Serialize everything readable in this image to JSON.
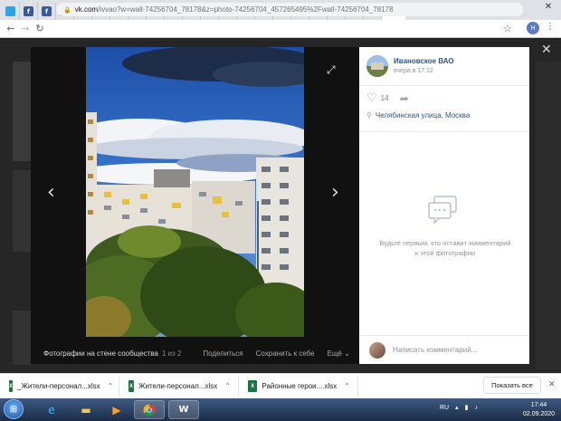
{
  "browser": {
    "tabs": [
      {
        "icon": "telegram-icon",
        "letter": "",
        "color": "#2ca5e0"
      },
      {
        "icon": "facebook-icon",
        "letter": "f",
        "color": "#3b5998"
      },
      {
        "icon": "facebook-icon",
        "letter": "f",
        "color": "#3b5998"
      },
      {
        "icon": "facebook-icon",
        "letter": "f",
        "color": "#3b5998"
      },
      {
        "icon": "globe-icon",
        "letter": "",
        "color": "#888888"
      },
      {
        "icon": "news-icon",
        "letter": "Н",
        "color": "#cfcfcf"
      },
      {
        "icon": "globe-icon",
        "letter": "",
        "color": "#888888"
      },
      {
        "icon": "warning-icon",
        "letter": "!",
        "color": "#e0b000"
      },
      {
        "icon": "document-icon",
        "letter": "",
        "color": "#4a7fd4"
      },
      {
        "icon": "google-icon",
        "letter": "G",
        "color": "#4285f4"
      },
      {
        "icon": "leaf-icon",
        "letter": "",
        "color": "#3fa34d"
      },
      {
        "icon": "globe-icon",
        "letter": "",
        "color": "#888888"
      },
      {
        "icon": "globe-icon",
        "letter": "",
        "color": "#888888"
      },
      {
        "icon": "emblem-icon",
        "letter": "",
        "color": "#c8a400"
      },
      {
        "icon": "globe-icon",
        "letter": "",
        "color": "#888888"
      },
      {
        "icon": "emblem-icon",
        "letter": "",
        "color": "#2d8bd0"
      },
      {
        "icon": "leaf-icon",
        "letter": "",
        "color": "#3fa34d"
      },
      {
        "icon": "globe-icon",
        "letter": "",
        "color": "#888888"
      },
      {
        "icon": "globe-icon",
        "letter": "",
        "color": "#888888"
      },
      {
        "icon": "globe-icon",
        "letter": "",
        "color": "#888888"
      },
      {
        "icon": "emblem-icon",
        "letter": "",
        "color": "#2d8bd0"
      }
    ],
    "url_host": "vk.com",
    "url_path": "/ivvao?w=wall-74256704_78178&z=photo-74256704_457265495%2Fwall-74256704_78178",
    "profile_letter": "Н",
    "new_tab_label": "+",
    "minimize_label": "—",
    "close_window_label": "✕"
  },
  "viewer": {
    "caption": "Фотографии на стене сообщества",
    "counter": "1 из 2",
    "actions": [
      "Поделиться",
      "Сохранить к себе",
      "Ещё"
    ],
    "prev_label": "‹",
    "next_label": "›",
    "close_label": "✕"
  },
  "panel": {
    "author": "Ивановское ВАО",
    "time": "вчера в 17:12",
    "likes": "14",
    "location": "Челябинская улица, Москва",
    "empty_comments": "Будьте первым, кто оставит комментарий к этой фотографии",
    "comment_placeholder": "Написать комментарий..."
  },
  "downloads": {
    "items": [
      {
        "name": "_Жители-персонал...xlsx"
      },
      {
        "name": "Жители-персонал...xlsx"
      },
      {
        "name": "Районные герои....xlsx"
      }
    ],
    "show_all": "Показать все"
  },
  "taskbar": {
    "lang": "RU",
    "time": "17:44",
    "date": "02.09.2020"
  },
  "colors": {
    "vk_blue": "#2a5885",
    "overlay": "#1f1f1f",
    "taskbar": "#1b2c48"
  }
}
